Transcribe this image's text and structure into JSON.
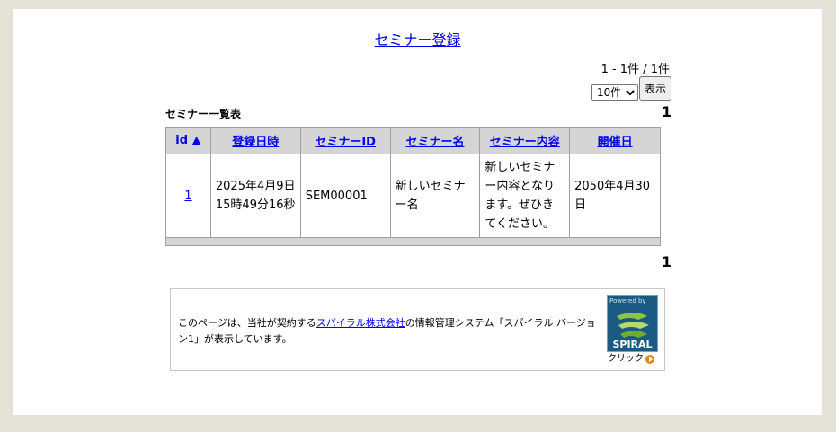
{
  "header": {
    "title_link": "セミナー登録"
  },
  "paging": {
    "info": "1 - 1件 / 1件",
    "per_page_selected": "10件",
    "show_button": "表示",
    "current_page": "1"
  },
  "list": {
    "title": "セミナー一覧表",
    "columns": [
      "id ▲",
      "登録日時",
      "セミナーID",
      "セミナー名",
      "セミナー内容",
      "開催日"
    ],
    "rows": [
      {
        "id": "1",
        "registered_at": "2025年4月9日 15時49分16秒",
        "seminar_id": "SEM00001",
        "seminar_name": "新しいセミナー名",
        "seminar_content": "新しいセミナー内容となります。ぜひきてください。",
        "date": "2050年4月30日"
      }
    ]
  },
  "notice": {
    "text_before": "このページは、当社が契約する",
    "link": "スパイラル株式会社",
    "text_after": "の情報管理システム「スパイラル バージョン1」が表示しています。",
    "badge_powered": "Powered by",
    "badge_logo": "SPIRAL",
    "badge_click": "クリック"
  },
  "colors": {
    "link": "#0000ee",
    "header_bg": "#d5d5d5",
    "outer_bg": "#e4e2d6",
    "logo_bg": "#1b5b83",
    "accent": "#e08a1e"
  }
}
